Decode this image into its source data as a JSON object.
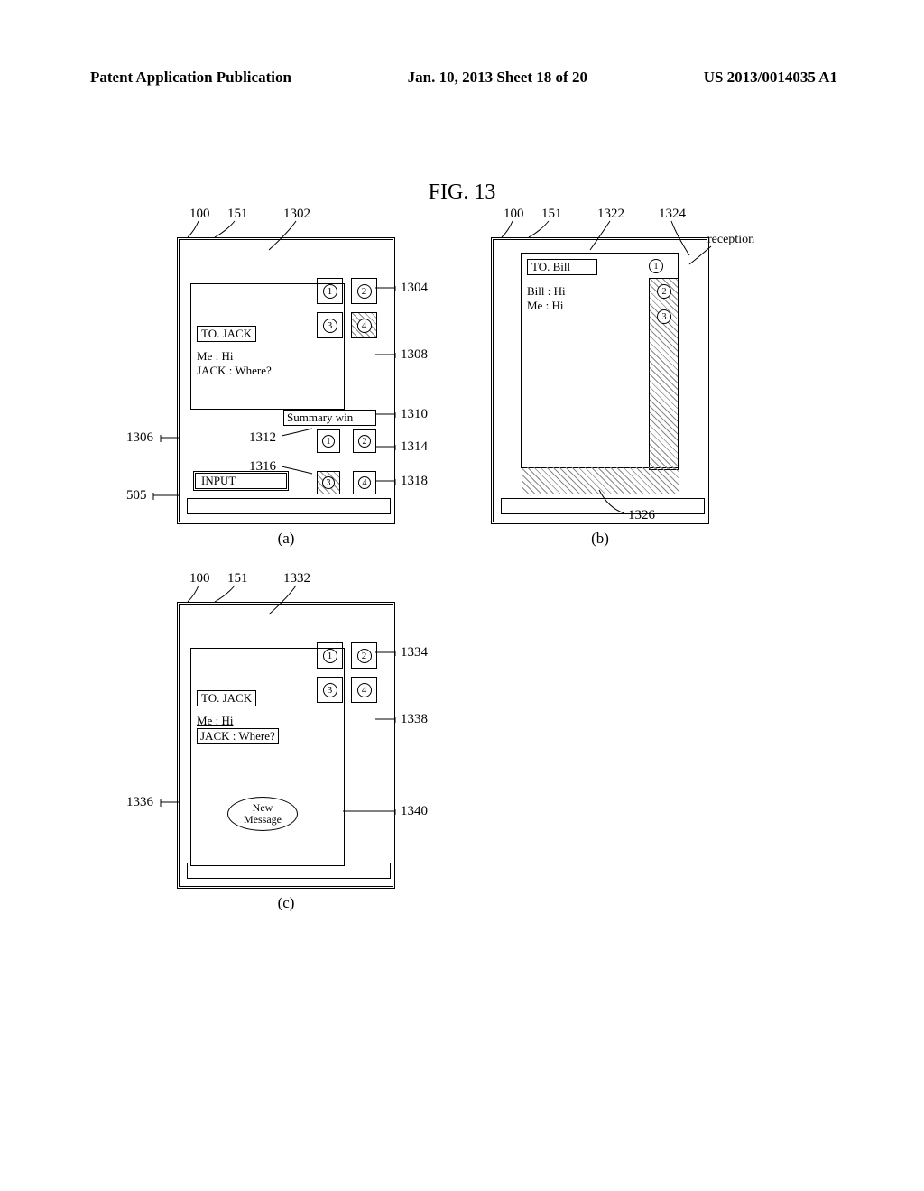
{
  "header": {
    "left": "Patent Application Publication",
    "center": "Jan. 10, 2013  Sheet 18 of 20",
    "right": "US 2013/0014035 A1"
  },
  "fig_title": "FIG. 13",
  "panel_a": {
    "top_refs": [
      "100",
      "151",
      "1302"
    ],
    "to_label": "TO. JACK",
    "messages": [
      "Me : Hi",
      "JACK : Where?"
    ],
    "summary_label": "Summary win",
    "input_label": "INPUT",
    "badges_top": [
      "1",
      "2",
      "3",
      "4"
    ],
    "badges_summary": [
      "1",
      "2",
      "3",
      "4"
    ],
    "side_refs": {
      "r1304": "1304",
      "r1306": "1306",
      "r1308": "1308",
      "r1310": "1310",
      "r1312": "1312",
      "r1314": "1314",
      "r1316": "1316",
      "r1318": "1318",
      "r505": "505"
    },
    "sub": "(a)"
  },
  "panel_b": {
    "top_refs": [
      "100",
      "151",
      "1322",
      "1324"
    ],
    "reception_label": "reception",
    "to_label": "TO. Bill",
    "messages": [
      "Bill : Hi",
      "Me : Hi"
    ],
    "circles": [
      "1",
      "2",
      "3"
    ],
    "ref_1326": "1326",
    "sub": "(b)"
  },
  "panel_c": {
    "top_refs": [
      "100",
      "151",
      "1332"
    ],
    "to_label": "TO. JACK",
    "msg1": "Me : Hi",
    "msg2": "JACK : Where?",
    "new_message": "New\nMessage",
    "badges_top": [
      "1",
      "2",
      "3",
      "4"
    ],
    "side_refs": {
      "r1334": "1334",
      "r1336": "1336",
      "r1338": "1338",
      "r1340": "1340"
    },
    "sub": "(c)"
  },
  "chart_data": {
    "type": "diagram",
    "figure": "FIG. 13",
    "description": "Patent drawing showing three mobile device UI states (a, b, c) with messaging windows and reference numerals",
    "panels": [
      {
        "label": "(a)",
        "device_ref": "100",
        "screen_ref": "151",
        "elements": [
          {
            "ref": "1302",
            "type": "top-area"
          },
          {
            "ref": "1304",
            "type": "badge-group-top",
            "items": [
              "1",
              "2",
              "3",
              "4"
            ]
          },
          {
            "ref": "1306",
            "type": "main-chat-window",
            "to": "JACK",
            "messages": [
              "Me : Hi",
              "JACK : Where?"
            ]
          },
          {
            "ref": "1308",
            "type": "message-area"
          },
          {
            "ref": "1310",
            "type": "summary-window-label",
            "text": "Summary win"
          },
          {
            "ref": "1312",
            "type": "summary-badge",
            "value": "1"
          },
          {
            "ref": "1314",
            "type": "summary-badge",
            "value": "2"
          },
          {
            "ref": "1316",
            "type": "summary-badge",
            "value": "3"
          },
          {
            "ref": "1318",
            "type": "summary-badge",
            "value": "4"
          },
          {
            "ref": "505",
            "type": "input-box",
            "text": "INPUT"
          }
        ]
      },
      {
        "label": "(b)",
        "device_ref": "100",
        "screen_ref": "151",
        "elements": [
          {
            "ref": "1322",
            "type": "chat-window",
            "to": "Bill",
            "messages": [
              "Bill : Hi",
              "Me : Hi"
            ],
            "badges": [
              "1",
              "2",
              "3"
            ]
          },
          {
            "ref": "1324",
            "type": "reception-indicator",
            "text": "reception"
          },
          {
            "ref": "1326",
            "type": "bottom-strip"
          }
        ]
      },
      {
        "label": "(c)",
        "device_ref": "100",
        "screen_ref": "151",
        "elements": [
          {
            "ref": "1332",
            "type": "top-area"
          },
          {
            "ref": "1334",
            "type": "badge-group-top",
            "items": [
              "1",
              "2",
              "3",
              "4"
            ]
          },
          {
            "ref": "1336",
            "type": "main-chat-window",
            "to": "JACK"
          },
          {
            "ref": "1338",
            "type": "message-area",
            "messages": [
              "Me : Hi",
              "JACK : Where?"
            ]
          },
          {
            "ref": "1340",
            "type": "new-message-indicator",
            "text": "New Message"
          }
        ]
      }
    ]
  }
}
